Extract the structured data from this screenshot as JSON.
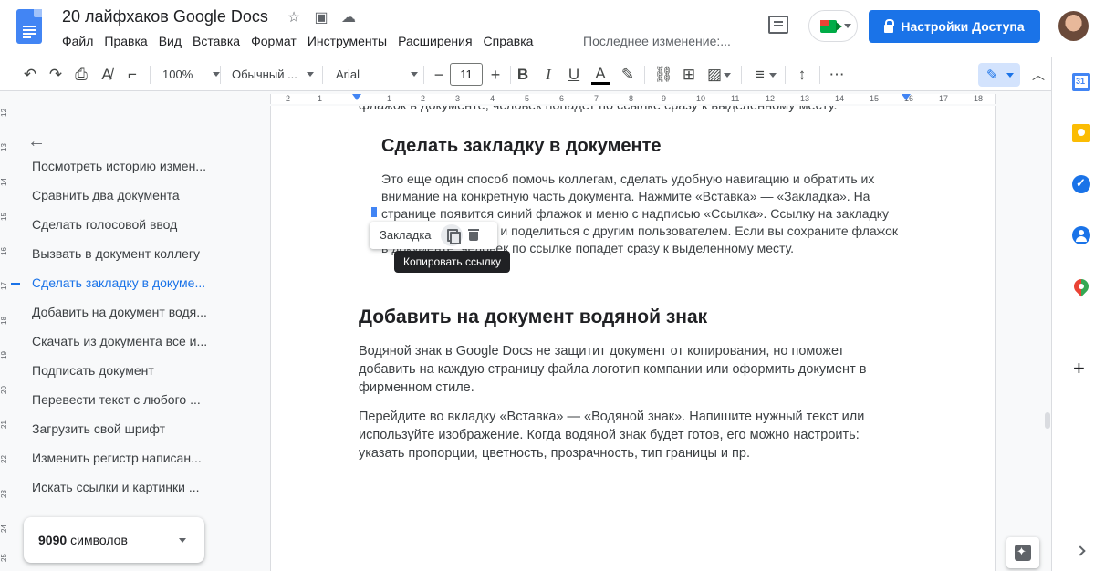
{
  "header": {
    "doc_title": "20 лайфхаков Google Docs",
    "menu": [
      "Файл",
      "Правка",
      "Вид",
      "Вставка",
      "Формат",
      "Инструменты",
      "Расширения",
      "Справка"
    ],
    "last_edit": "Последнее изменение:...",
    "share_label": "Настройки Доступа"
  },
  "toolbar": {
    "zoom": "100%",
    "style": "Обычный ...",
    "font": "Arial",
    "font_size": "11",
    "minus": "−",
    "plus": "+",
    "bold": "B",
    "italic": "I",
    "underline": "U",
    "text_color": "A"
  },
  "ruler": {
    "labels": [
      "2",
      "1",
      "1",
      "2",
      "3",
      "4",
      "5",
      "6",
      "7",
      "8",
      "9",
      "10",
      "11",
      "12",
      "13",
      "14",
      "15",
      "16",
      "17",
      "18"
    ]
  },
  "vruler": {
    "labels": [
      "12",
      "13",
      "14",
      "15",
      "16",
      "17",
      "18",
      "19",
      "20",
      "21",
      "22",
      "23",
      "24",
      "25"
    ]
  },
  "outline": {
    "items": [
      "Посмотреть историю измен...",
      "Сравнить два документа",
      "Сделать голосовой ввод",
      "Вызвать в документ коллегу",
      "Сделать закладку в докуме...",
      "Добавить на документ водя...",
      "Скачать из документа все и...",
      "Подписать документ",
      "Перевести текст с любого ...",
      "Загрузить свой шрифт",
      "Изменить регистр написан...",
      "Искать ссылки и картинки ..."
    ],
    "active_index": 4,
    "word_count_number": "9090",
    "word_count_unit": "символов"
  },
  "document": {
    "top_line": "флажок в документе, человек попадет по ссылке сразу к выделенному месту.",
    "h_bookmark": "Сделать закладку в документе",
    "p_bookmark": [
      "Это еще один способ помочь коллегам, сделать удобную навигацию и обратить их",
      "внимание на конкретную часть документа. Нажмите «Вставка» — «Закладка». На",
      "странице появится синий флажок и меню с надписью «Ссылка». Ссылку на закладку",
      "можно скопировать и поделиться с другим пользователем. Если вы сохраните флажок",
      "в документе, человек по ссылке попадет сразу к выделенному месту."
    ],
    "bookmark_popup_label": "Закладка",
    "tooltip": "Копировать ссылку",
    "h_watermark": "Добавить на документ водяной знак",
    "p_watermark_1": [
      "Водяной знак в Google Docs не защитит документ от копирования, но поможет",
      "добавить на каждую страницу файла логотип компании или оформить документ в",
      "фирменном стиле."
    ],
    "p_watermark_2": [
      "Перейдите во вкладку «Вставка» — «Водяной знак». Напишите нужный текст или",
      "используйте изображение. Когда водяной знак будет готов, его можно настроить:",
      "указать пропорции, цветность, прозрачность, тип границы и пр."
    ]
  },
  "colors": {
    "accent": "#1a73e8",
    "doc_blue": "#4285f4"
  }
}
